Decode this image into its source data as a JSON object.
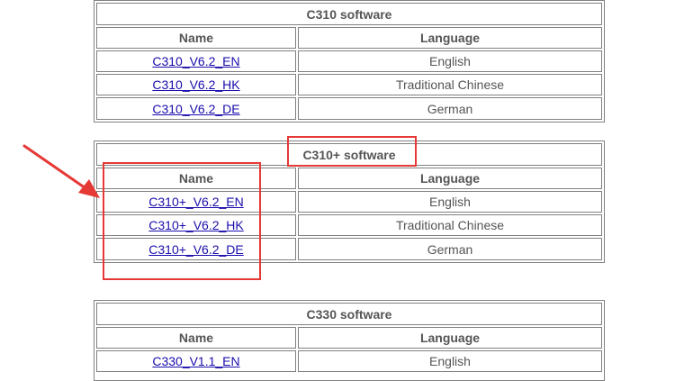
{
  "colors": {
    "annotation": "#e53935",
    "link": "#1a0dab",
    "border": "#808080",
    "text": "#555555"
  },
  "tables": [
    {
      "title": "C310 software",
      "headers": {
        "name": "Name",
        "language": "Language"
      },
      "rows": [
        {
          "name": "C310_V6.2_EN",
          "language": "English"
        },
        {
          "name": "C310_V6.2_HK",
          "language": "Traditional Chinese"
        },
        {
          "name": "C310_V6.2_DE",
          "language": "German"
        }
      ]
    },
    {
      "title": "C310+ software",
      "headers": {
        "name": "Name",
        "language": "Language"
      },
      "rows": [
        {
          "name": "C310+_V6.2_EN",
          "language": "English"
        },
        {
          "name": "C310+_V6.2_HK",
          "language": "Traditional Chinese"
        },
        {
          "name": "C310+_V6.2_DE",
          "language": "German"
        }
      ]
    },
    {
      "title": "C330 software",
      "headers": {
        "name": "Name",
        "language": "Language"
      },
      "rows": [
        {
          "name": "C330_V1.1_EN",
          "language": "English"
        }
      ]
    }
  ]
}
